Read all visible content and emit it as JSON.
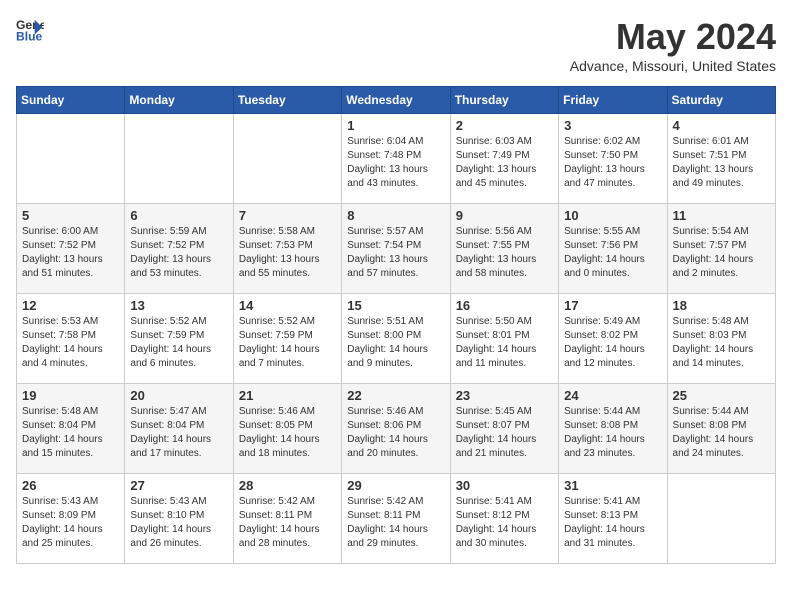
{
  "header": {
    "logo_general": "General",
    "logo_blue": "Blue",
    "month_year": "May 2024",
    "location": "Advance, Missouri, United States"
  },
  "days_of_week": [
    "Sunday",
    "Monday",
    "Tuesday",
    "Wednesday",
    "Thursday",
    "Friday",
    "Saturday"
  ],
  "weeks": [
    [
      {
        "day": "",
        "info": ""
      },
      {
        "day": "",
        "info": ""
      },
      {
        "day": "",
        "info": ""
      },
      {
        "day": "1",
        "info": "Sunrise: 6:04 AM\nSunset: 7:48 PM\nDaylight: 13 hours\nand 43 minutes."
      },
      {
        "day": "2",
        "info": "Sunrise: 6:03 AM\nSunset: 7:49 PM\nDaylight: 13 hours\nand 45 minutes."
      },
      {
        "day": "3",
        "info": "Sunrise: 6:02 AM\nSunset: 7:50 PM\nDaylight: 13 hours\nand 47 minutes."
      },
      {
        "day": "4",
        "info": "Sunrise: 6:01 AM\nSunset: 7:51 PM\nDaylight: 13 hours\nand 49 minutes."
      }
    ],
    [
      {
        "day": "5",
        "info": "Sunrise: 6:00 AM\nSunset: 7:52 PM\nDaylight: 13 hours\nand 51 minutes."
      },
      {
        "day": "6",
        "info": "Sunrise: 5:59 AM\nSunset: 7:52 PM\nDaylight: 13 hours\nand 53 minutes."
      },
      {
        "day": "7",
        "info": "Sunrise: 5:58 AM\nSunset: 7:53 PM\nDaylight: 13 hours\nand 55 minutes."
      },
      {
        "day": "8",
        "info": "Sunrise: 5:57 AM\nSunset: 7:54 PM\nDaylight: 13 hours\nand 57 minutes."
      },
      {
        "day": "9",
        "info": "Sunrise: 5:56 AM\nSunset: 7:55 PM\nDaylight: 13 hours\nand 58 minutes."
      },
      {
        "day": "10",
        "info": "Sunrise: 5:55 AM\nSunset: 7:56 PM\nDaylight: 14 hours\nand 0 minutes."
      },
      {
        "day": "11",
        "info": "Sunrise: 5:54 AM\nSunset: 7:57 PM\nDaylight: 14 hours\nand 2 minutes."
      }
    ],
    [
      {
        "day": "12",
        "info": "Sunrise: 5:53 AM\nSunset: 7:58 PM\nDaylight: 14 hours\nand 4 minutes."
      },
      {
        "day": "13",
        "info": "Sunrise: 5:52 AM\nSunset: 7:59 PM\nDaylight: 14 hours\nand 6 minutes."
      },
      {
        "day": "14",
        "info": "Sunrise: 5:52 AM\nSunset: 7:59 PM\nDaylight: 14 hours\nand 7 minutes."
      },
      {
        "day": "15",
        "info": "Sunrise: 5:51 AM\nSunset: 8:00 PM\nDaylight: 14 hours\nand 9 minutes."
      },
      {
        "day": "16",
        "info": "Sunrise: 5:50 AM\nSunset: 8:01 PM\nDaylight: 14 hours\nand 11 minutes."
      },
      {
        "day": "17",
        "info": "Sunrise: 5:49 AM\nSunset: 8:02 PM\nDaylight: 14 hours\nand 12 minutes."
      },
      {
        "day": "18",
        "info": "Sunrise: 5:48 AM\nSunset: 8:03 PM\nDaylight: 14 hours\nand 14 minutes."
      }
    ],
    [
      {
        "day": "19",
        "info": "Sunrise: 5:48 AM\nSunset: 8:04 PM\nDaylight: 14 hours\nand 15 minutes."
      },
      {
        "day": "20",
        "info": "Sunrise: 5:47 AM\nSunset: 8:04 PM\nDaylight: 14 hours\nand 17 minutes."
      },
      {
        "day": "21",
        "info": "Sunrise: 5:46 AM\nSunset: 8:05 PM\nDaylight: 14 hours\nand 18 minutes."
      },
      {
        "day": "22",
        "info": "Sunrise: 5:46 AM\nSunset: 8:06 PM\nDaylight: 14 hours\nand 20 minutes."
      },
      {
        "day": "23",
        "info": "Sunrise: 5:45 AM\nSunset: 8:07 PM\nDaylight: 14 hours\nand 21 minutes."
      },
      {
        "day": "24",
        "info": "Sunrise: 5:44 AM\nSunset: 8:08 PM\nDaylight: 14 hours\nand 23 minutes."
      },
      {
        "day": "25",
        "info": "Sunrise: 5:44 AM\nSunset: 8:08 PM\nDaylight: 14 hours\nand 24 minutes."
      }
    ],
    [
      {
        "day": "26",
        "info": "Sunrise: 5:43 AM\nSunset: 8:09 PM\nDaylight: 14 hours\nand 25 minutes."
      },
      {
        "day": "27",
        "info": "Sunrise: 5:43 AM\nSunset: 8:10 PM\nDaylight: 14 hours\nand 26 minutes."
      },
      {
        "day": "28",
        "info": "Sunrise: 5:42 AM\nSunset: 8:11 PM\nDaylight: 14 hours\nand 28 minutes."
      },
      {
        "day": "29",
        "info": "Sunrise: 5:42 AM\nSunset: 8:11 PM\nDaylight: 14 hours\nand 29 minutes."
      },
      {
        "day": "30",
        "info": "Sunrise: 5:41 AM\nSunset: 8:12 PM\nDaylight: 14 hours\nand 30 minutes."
      },
      {
        "day": "31",
        "info": "Sunrise: 5:41 AM\nSunset: 8:13 PM\nDaylight: 14 hours\nand 31 minutes."
      },
      {
        "day": "",
        "info": ""
      }
    ]
  ]
}
